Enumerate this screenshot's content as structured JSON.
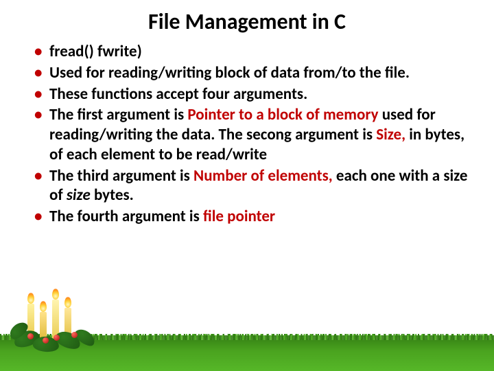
{
  "title": "File Management in C",
  "bullets": {
    "b1": "fread()   fwrite)",
    "b2": "Used for reading/writing block of data from/to the file.",
    "b3": "These functions accept four arguments.",
    "b4_a": "The first argument is ",
    "b4_b": "Pointer to a block of memory",
    "b4_c": " used for reading/writing the data. The secong argument is ",
    "b4_d": "Size,",
    "b4_e": " in bytes, of each element to be read/write",
    "b5_a": "The third argument is ",
    "b5_b": "Number of elements,",
    "b5_c": " each one with a size of ",
    "b5_d": "size",
    "b5_e": " bytes.",
    "b6_a": "The fourth argument is ",
    "b6_b": "file pointer"
  }
}
